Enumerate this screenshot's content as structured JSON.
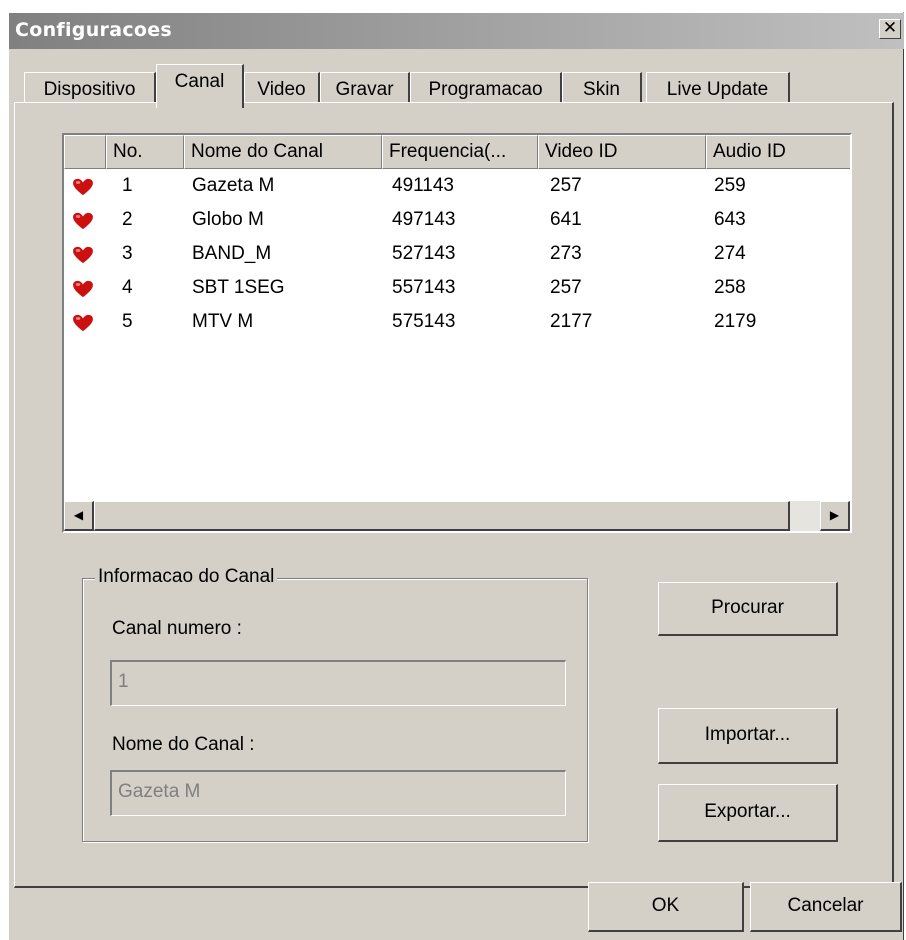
{
  "window": {
    "title": "Configuracoes",
    "close_glyph": "✕"
  },
  "tabs": [
    {
      "label": "Dispositivo",
      "active": false
    },
    {
      "label": "Canal",
      "active": true
    },
    {
      "label": "Video",
      "active": false
    },
    {
      "label": "Gravar",
      "active": false
    },
    {
      "label": "Programacao",
      "active": false
    },
    {
      "label": "Skin",
      "active": false
    },
    {
      "label": "Live Update",
      "active": false
    }
  ],
  "channel_list": {
    "columns": [
      "",
      "No.",
      "Nome do Canal",
      "Frequencia(...",
      "Video ID",
      "Audio ID"
    ],
    "rows": [
      {
        "no": "1",
        "name": "Gazeta M",
        "freq": "491143",
        "video": "257",
        "audio": "259"
      },
      {
        "no": "2",
        "name": "Globo M",
        "freq": "497143",
        "video": "641",
        "audio": "643"
      },
      {
        "no": "3",
        "name": "BAND_M",
        "freq": "527143",
        "video": "273",
        "audio": "274"
      },
      {
        "no": "4",
        "name": "SBT 1SEG",
        "freq": "557143",
        "video": "257",
        "audio": "258"
      },
      {
        "no": "5",
        "name": "MTV M",
        "freq": "575143",
        "video": "2177",
        "audio": "2179"
      }
    ],
    "row_icon": "heart-icon",
    "scroll_left": "◀",
    "scroll_right": "▶"
  },
  "info": {
    "group_title": "Informacao do Canal",
    "number_label": "Canal numero :",
    "number_value": "1",
    "name_label": "Nome do Canal :",
    "name_value": "Gazeta M"
  },
  "buttons": {
    "search": "Procurar",
    "import": "Importar...",
    "export": "Exportar...",
    "ok": "OK",
    "cancel": "Cancelar"
  },
  "colors": {
    "face": "#d4d0c8",
    "heart": "#cc1010",
    "title_gradient_start": "#808080"
  }
}
